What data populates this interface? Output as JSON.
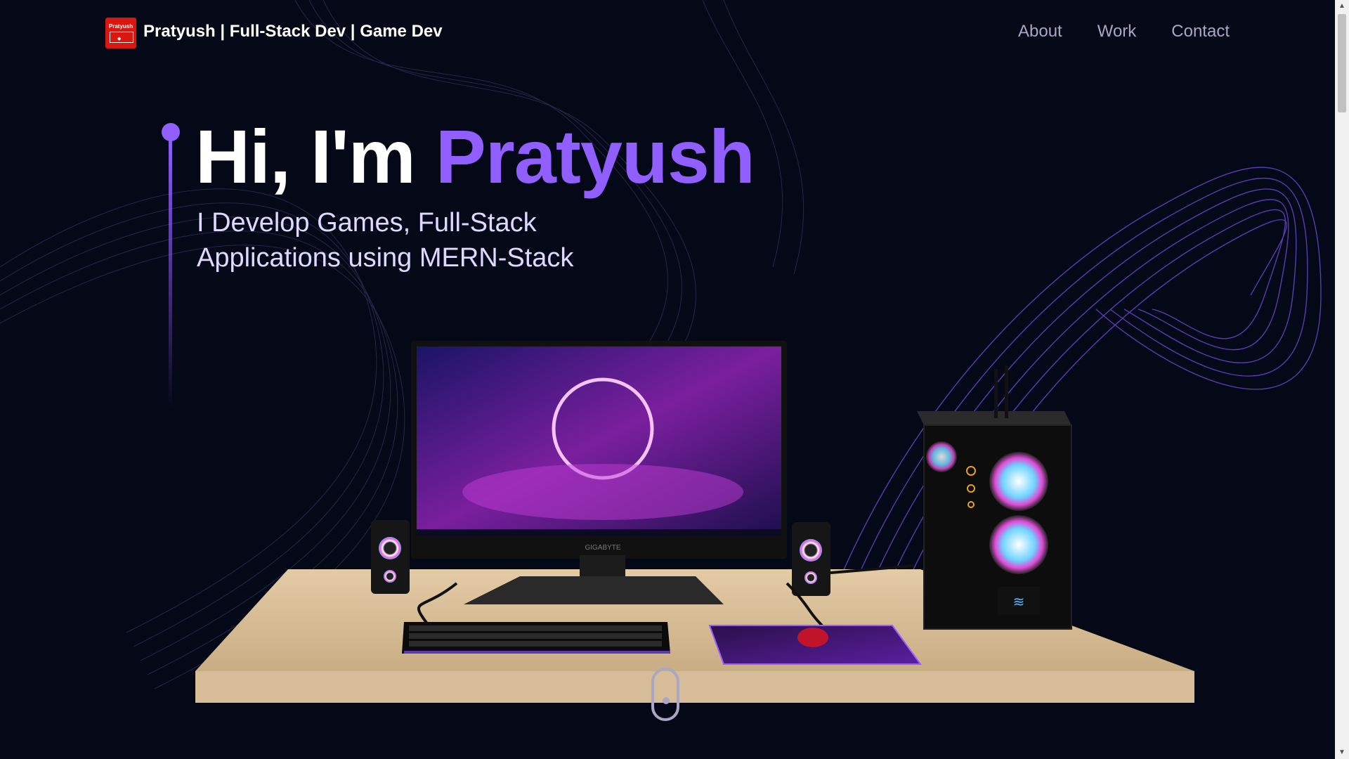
{
  "nav": {
    "logo_text": "Pratyush",
    "brand": "Pratyush |  Full-Stack Dev | Game Dev",
    "links": [
      "About",
      "Work",
      "Contact"
    ]
  },
  "hero": {
    "greeting": "Hi, I'm ",
    "name": "Pratyush",
    "subtitle": "I Develop Games, Full-Stack Applications using MERN-Stack"
  },
  "scene": {
    "monitor_brand": "GIGABYTE"
  },
  "colors": {
    "background": "#050816",
    "accent": "#915eff",
    "nav_text": "#aaa6c3",
    "logo_bg": "#d9160f"
  },
  "icons": [
    "scroll-mouse-icon",
    "scroll-up-arrow-icon",
    "scroll-down-arrow-icon"
  ]
}
